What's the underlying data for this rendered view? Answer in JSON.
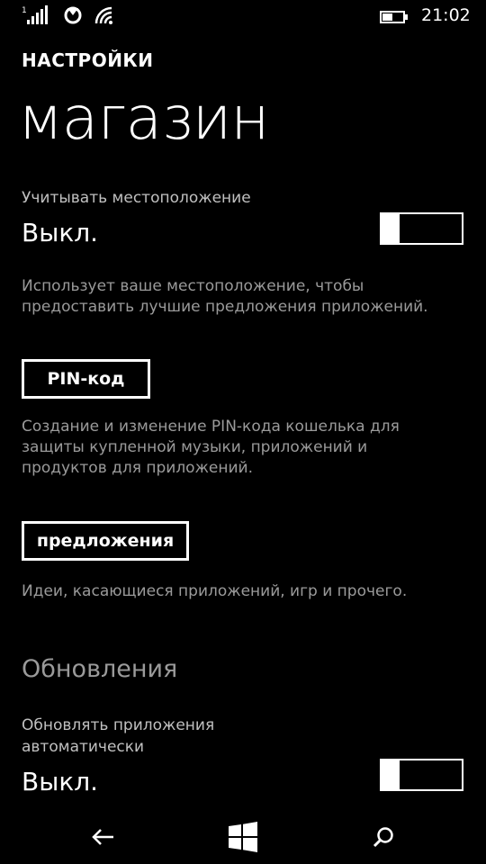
{
  "status_bar": {
    "time": "21:02",
    "icons": [
      "signal-icon",
      "data-sim-icon",
      "wifi-icon",
      "battery-icon"
    ],
    "signal_marker": "1"
  },
  "header": {
    "app_name": "НАСТРОЙКИ",
    "page_title": "магазин"
  },
  "location": {
    "label": "Учитывать местоположение",
    "value": "Выкл.",
    "toggle_on": false,
    "description": "Использует ваше местоположение, чтобы предоставить лучшие предложения приложений."
  },
  "pin": {
    "button_label": "PIN-код",
    "description": "Создание и изменение PIN-кода кошелька для защиты купленной музыки, приложений и продуктов для приложений."
  },
  "offers": {
    "button_label": "предложения",
    "description": "Идеи, касающиеся приложений, игр и прочего."
  },
  "updates": {
    "section_title": "Обновления",
    "auto_label": "Обновлять приложения автоматически",
    "value": "Выкл.",
    "toggle_on": false
  },
  "nav": {
    "icons": [
      "back-arrow-icon",
      "windows-start-icon",
      "search-icon"
    ]
  }
}
